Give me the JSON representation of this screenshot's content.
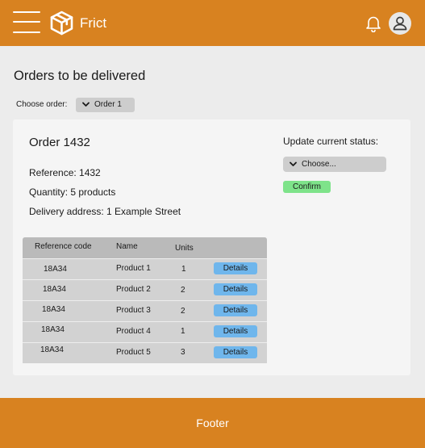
{
  "header": {
    "brand": "Frict"
  },
  "page": {
    "title": "Orders to be delivered",
    "choose_label": "Choose order:",
    "selected_order": "Order 1"
  },
  "order": {
    "title": "Order 1432",
    "reference": "Reference: 1432",
    "quantity": "Quantity: 5 products",
    "address": "Delivery address: 1 Example Street"
  },
  "status": {
    "label": "Update current status:",
    "placeholder": "Choose...",
    "confirm_label": "Confirm"
  },
  "table": {
    "headers": [
      "Reference code",
      "Name",
      "Units"
    ],
    "rows": [
      {
        "ref": "18A34",
        "name": "Product 1",
        "units": "1",
        "action": "Details"
      },
      {
        "ref": "18A34",
        "name": "Product 2",
        "units": "2",
        "action": "Details"
      },
      {
        "ref": "18A34",
        "name": "Product 3",
        "units": "2",
        "action": "Details"
      },
      {
        "ref": "18A34",
        "name": "Product 4",
        "units": "1",
        "action": "Details"
      },
      {
        "ref": "18A34",
        "name": "Product 5",
        "units": "3",
        "action": "Details"
      }
    ]
  },
  "footer": {
    "text": "Footer"
  },
  "icons": {
    "menu": "hamburger-icon",
    "logo": "box-icon",
    "bell": "bell-icon",
    "avatar": "user-icon",
    "chevron": "chevron-down-icon"
  },
  "colors": {
    "brand": "#d88220",
    "confirm": "#7ee38a",
    "details": "#6fb6ec"
  }
}
